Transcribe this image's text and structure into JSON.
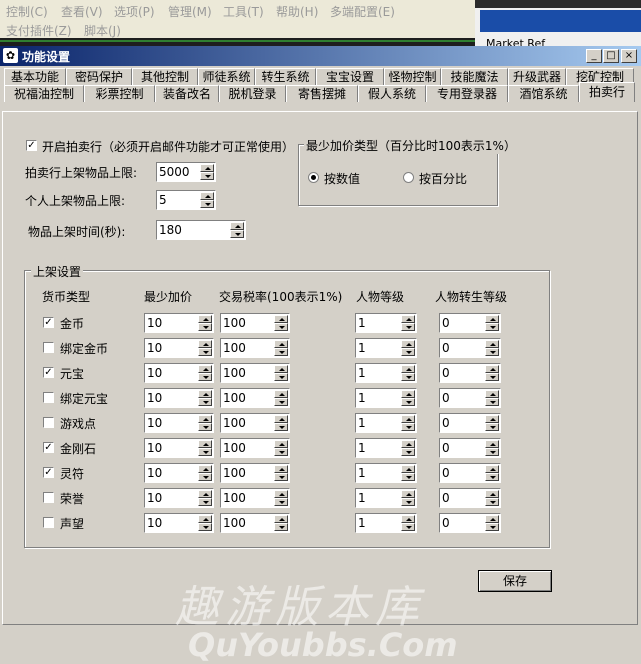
{
  "parent_menu": {
    "row1": [
      "控制(C)",
      "查看(V)",
      "选项(P)",
      "管理(M)",
      "工具(T)",
      "帮助(H)",
      "多端配置(E)"
    ],
    "row2": [
      "支付插件(Z)",
      "脚本(J)"
    ],
    "right_text": "Market Ref"
  },
  "window": {
    "title": "功能设置",
    "min_label": "_",
    "max_label": "□",
    "close_label": "×"
  },
  "tabs_row1": [
    "基本功能",
    "密码保护",
    "其他控制",
    "师徒系统",
    "转生系统",
    "宝宝设置",
    "怪物控制",
    "技能魔法",
    "升级武器",
    "挖矿控制"
  ],
  "tabs_row2": [
    "祝福油控制",
    "彩票控制",
    "装备改名",
    "脱机登录",
    "寄售摆摊",
    "假人系统",
    "专用登录器",
    "酒馆系统",
    "拍卖行"
  ],
  "auction": {
    "enable_label": "开启拍卖行（必须开启邮件功能才可正常使用）",
    "enable_checked": true,
    "max_items_label": "拍卖行上架物品上限:",
    "max_items_value": "5000",
    "personal_max_label": "个人上架物品上限:",
    "personal_max_value": "5",
    "duration_label": "物品上架时间(秒):",
    "duration_value": "180",
    "min_raise_group": "最少加价类型（百分比时100表示1%）",
    "radio_value": "按数值",
    "radio_percent": "按百分比",
    "radio_selected": "value"
  },
  "listing": {
    "group_title": "上架设置",
    "headers": [
      "货币类型",
      "最少加价",
      "交易税率(100表示1%)",
      "人物等级",
      "人物转生等级"
    ],
    "rows": [
      {
        "name": "金币",
        "checked": true,
        "min_raise": "10",
        "tax": "100",
        "level": "1",
        "rebirth": "0"
      },
      {
        "name": "绑定金币",
        "checked": false,
        "min_raise": "10",
        "tax": "100",
        "level": "1",
        "rebirth": "0"
      },
      {
        "name": "元宝",
        "checked": true,
        "min_raise": "10",
        "tax": "100",
        "level": "1",
        "rebirth": "0"
      },
      {
        "name": "绑定元宝",
        "checked": false,
        "min_raise": "10",
        "tax": "100",
        "level": "1",
        "rebirth": "0"
      },
      {
        "name": "游戏点",
        "checked": false,
        "min_raise": "10",
        "tax": "100",
        "level": "1",
        "rebirth": "0"
      },
      {
        "name": "金刚石",
        "checked": true,
        "min_raise": "10",
        "tax": "100",
        "level": "1",
        "rebirth": "0"
      },
      {
        "name": "灵符",
        "checked": true,
        "min_raise": "10",
        "tax": "100",
        "level": "1",
        "rebirth": "0"
      },
      {
        "name": "荣誉",
        "checked": false,
        "min_raise": "10",
        "tax": "100",
        "level": "1",
        "rebirth": "0"
      },
      {
        "name": "声望",
        "checked": false,
        "min_raise": "10",
        "tax": "100",
        "level": "1",
        "rebirth": "0"
      }
    ]
  },
  "save_label": "保存",
  "watermark": {
    "cn": "趣游版本库",
    "en": "QuYoubbs.Com"
  }
}
